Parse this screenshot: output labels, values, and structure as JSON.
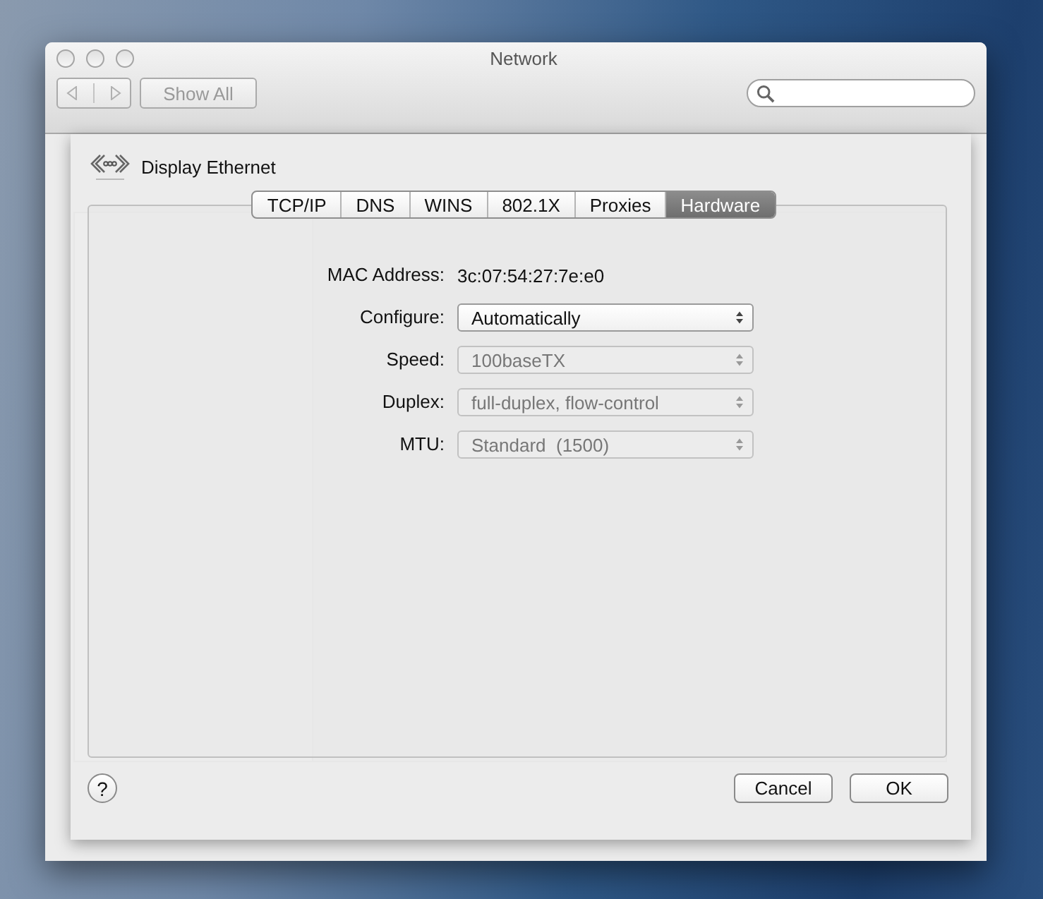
{
  "window": {
    "title": "Network",
    "toolbar": {
      "show_all": "Show All"
    }
  },
  "sheet": {
    "interface": "Display Ethernet",
    "tabs": [
      {
        "label": "TCP/IP",
        "selected": false
      },
      {
        "label": "DNS",
        "selected": false
      },
      {
        "label": "WINS",
        "selected": false
      },
      {
        "label": "802.1X",
        "selected": false
      },
      {
        "label": "Proxies",
        "selected": false
      },
      {
        "label": "Hardware",
        "selected": true
      }
    ],
    "fields": [
      {
        "kind": "text",
        "label": "MAC Address:",
        "value": "3c:07:54:27:7e:e0"
      },
      {
        "kind": "popup",
        "label": "Configure:",
        "value": "Automatically",
        "disabled": false
      },
      {
        "kind": "popup",
        "label": "Speed:",
        "value": "100baseTX",
        "disabled": true
      },
      {
        "kind": "popup",
        "label": "Duplex:",
        "value": "full-duplex, flow-control",
        "disabled": true
      },
      {
        "kind": "popup",
        "label": "MTU:",
        "value": "Standard  (1500)",
        "disabled": true
      }
    ],
    "help": "?",
    "buttons": [
      "Cancel",
      "OK"
    ]
  }
}
